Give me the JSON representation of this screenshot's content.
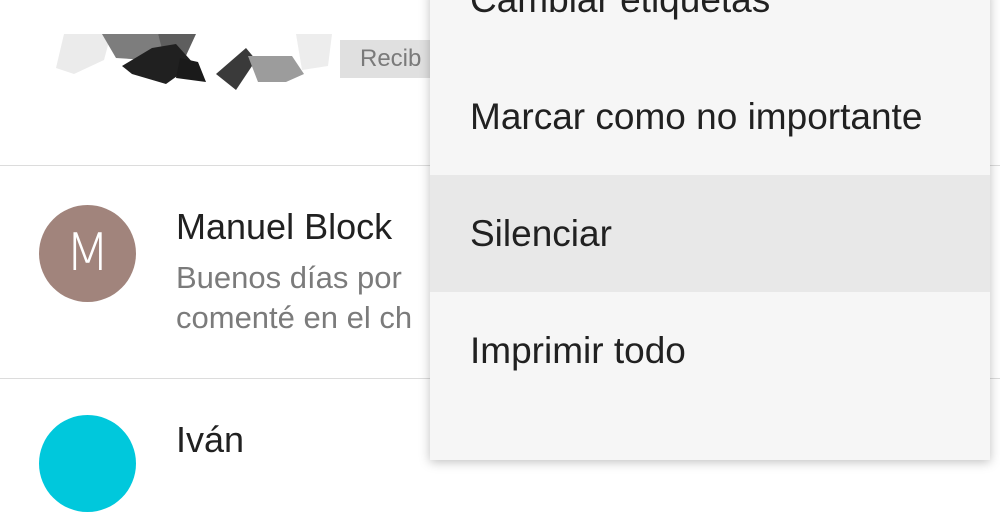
{
  "email_list": {
    "top_row": {
      "label_chip": "Recib"
    },
    "rows": [
      {
        "avatar_letter": "M",
        "avatar_color": "#a1847c",
        "sender": "Manuel Block",
        "snippet_line1": "Buenos días por",
        "snippet_line2": "comenté en el ch"
      },
      {
        "avatar_letter": "",
        "avatar_color": "#00c8dc",
        "sender": "Iván"
      }
    ]
  },
  "menu": {
    "items": [
      {
        "label": "Cambiar etiquetas"
      },
      {
        "label": "Marcar como no importante"
      },
      {
        "label": "Silenciar",
        "selected": true
      },
      {
        "label": "Imprimir todo"
      }
    ]
  },
  "colors": {
    "menu_background": "#f6f6f6",
    "menu_selected": "#e8e8e8"
  }
}
